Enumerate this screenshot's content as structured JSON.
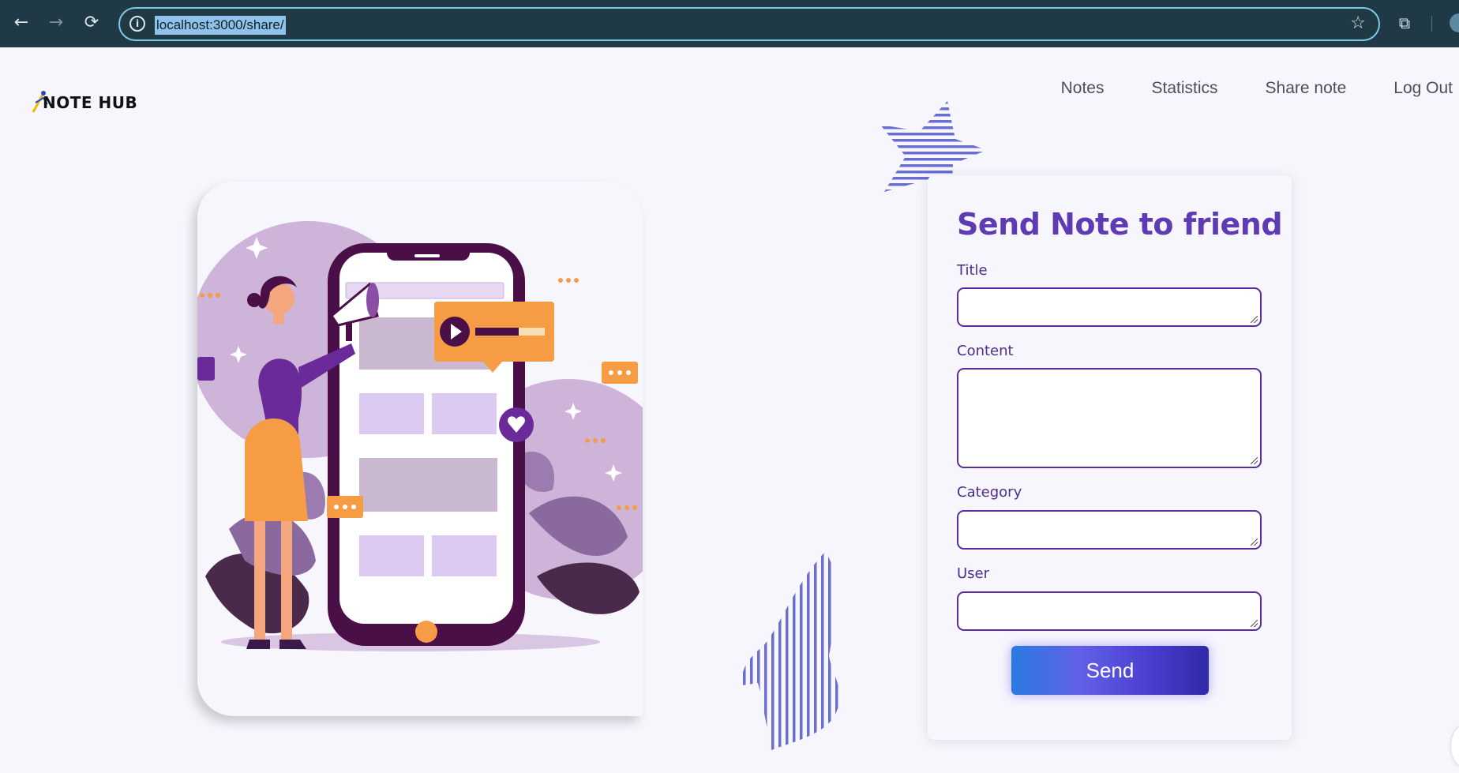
{
  "browser": {
    "back_icon": "←",
    "forward_icon": "→",
    "reload_icon": "⟳",
    "info_icon": "i",
    "url": "localhost:3000/share/",
    "star_icon": "☆",
    "extensions_icon": "⧉"
  },
  "header": {
    "logo_text": "NOTE HUB",
    "nav": [
      "Notes",
      "Statistics",
      "Share note",
      "Log Out"
    ]
  },
  "form": {
    "title": "Send Note to friend",
    "title_label": "Title",
    "title_value": "",
    "content_label": "Content",
    "content_value": "",
    "category_label": "Category",
    "category_value": "",
    "user_label": "User",
    "user_value": "",
    "send_label": "Send"
  },
  "colors": {
    "accent": "#5f3bb3",
    "field_border": "#5a2c9c",
    "button_gradient_start": "#2a7be0",
    "button_gradient_end": "#2f2aa8",
    "chrome_bg": "#1f3a46"
  }
}
